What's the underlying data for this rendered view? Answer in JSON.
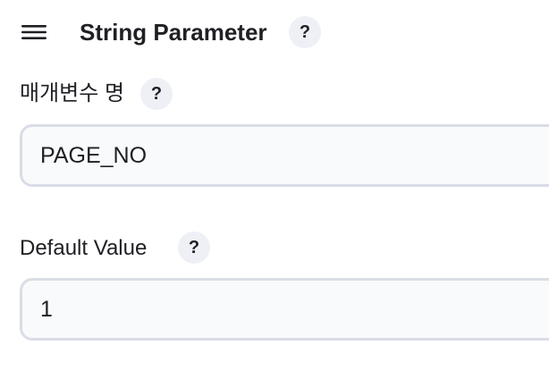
{
  "section": {
    "title": "String Parameter",
    "help_label": "?",
    "icon": "hamburger-drag-icon"
  },
  "fields": {
    "name": {
      "label": "매개변수 명",
      "help_label": "?",
      "value": "PAGE_NO"
    },
    "default_value": {
      "label": "Default Value",
      "help_label": "?",
      "value": "1"
    }
  },
  "colors": {
    "text": "#1f1f24",
    "help_bg": "#eef0f6",
    "input_border": "#dadde6",
    "input_bg": "#f9fafc"
  }
}
